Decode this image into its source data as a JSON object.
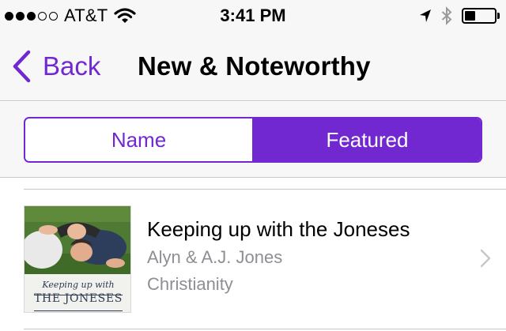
{
  "status_bar": {
    "signal_bars_filled": 3,
    "signal_bars_total": 5,
    "carrier": "AT&T",
    "time": "3:41 PM",
    "battery_level": 0.35,
    "icons": [
      "wifi-icon",
      "location-arrow-icon",
      "bluetooth-icon",
      "battery-icon"
    ]
  },
  "nav": {
    "back_label": "Back",
    "title": "New & Noteworthy"
  },
  "segments": [
    {
      "label": "Name",
      "selected": false
    },
    {
      "label": "Featured",
      "selected": true
    }
  ],
  "list": {
    "items": [
      {
        "title": "Keeping up with the Joneses",
        "artist": "Alyn & A.J. Jones",
        "category": "Christianity",
        "artwork": {
          "script_text": "Keeping up with",
          "name_text": "THE JONESES"
        }
      }
    ]
  },
  "colors": {
    "accent": "#7228d1",
    "bar_background": "#f7f7f8",
    "secondary_text": "#8e8e93",
    "separator": "#c8c7cc"
  }
}
